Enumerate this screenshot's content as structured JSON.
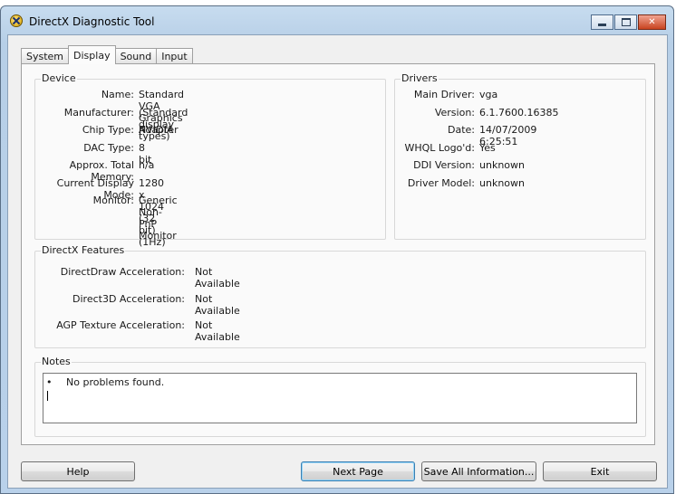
{
  "window": {
    "title": "DirectX Diagnostic Tool"
  },
  "tabs": [
    {
      "label": "System",
      "active": false
    },
    {
      "label": "Display",
      "active": true
    },
    {
      "label": "Sound",
      "active": false
    },
    {
      "label": "Input",
      "active": false
    }
  ],
  "device": {
    "title": "Device",
    "rows": [
      {
        "label": "Name:",
        "value": "Standard VGA Graphics Adapter"
      },
      {
        "label": "Manufacturer:",
        "value": "(Standard display types)"
      },
      {
        "label": "Chip Type:",
        "value": "NVIDIA"
      },
      {
        "label": "DAC Type:",
        "value": "8 bit"
      },
      {
        "label": "Approx. Total Memory:",
        "value": "n/a"
      },
      {
        "label": "Current Display Mode:",
        "value": "1280 x 1024 (32 bit) (1Hz)"
      },
      {
        "label": "Monitor:",
        "value": "Generic Non-PnP Monitor"
      }
    ]
  },
  "drivers": {
    "title": "Drivers",
    "rows": [
      {
        "label": "Main Driver:",
        "value": "vga"
      },
      {
        "label": "Version:",
        "value": "6.1.7600.16385"
      },
      {
        "label": "Date:",
        "value": "14/07/2009 6:25:51"
      },
      {
        "label": "WHQL Logo'd:",
        "value": "Yes"
      },
      {
        "label": "DDI Version:",
        "value": "unknown"
      },
      {
        "label": "Driver Model:",
        "value": "unknown"
      }
    ]
  },
  "features": {
    "title": "DirectX Features",
    "rows": [
      {
        "label": "DirectDraw Acceleration:",
        "value": "Not Available"
      },
      {
        "label": "Direct3D Acceleration:",
        "value": "Not Available"
      },
      {
        "label": "AGP Texture Acceleration:",
        "value": "Not Available"
      }
    ]
  },
  "notes": {
    "title": "Notes",
    "bullet": "•",
    "items": [
      "No problems found."
    ]
  },
  "buttons": {
    "help": "Help",
    "next": "Next Page",
    "save": "Save All Information...",
    "exit": "Exit"
  },
  "icons": {
    "app": "directx-icon",
    "min": "minimize-icon",
    "max": "maximize-icon",
    "close": "close-icon"
  }
}
